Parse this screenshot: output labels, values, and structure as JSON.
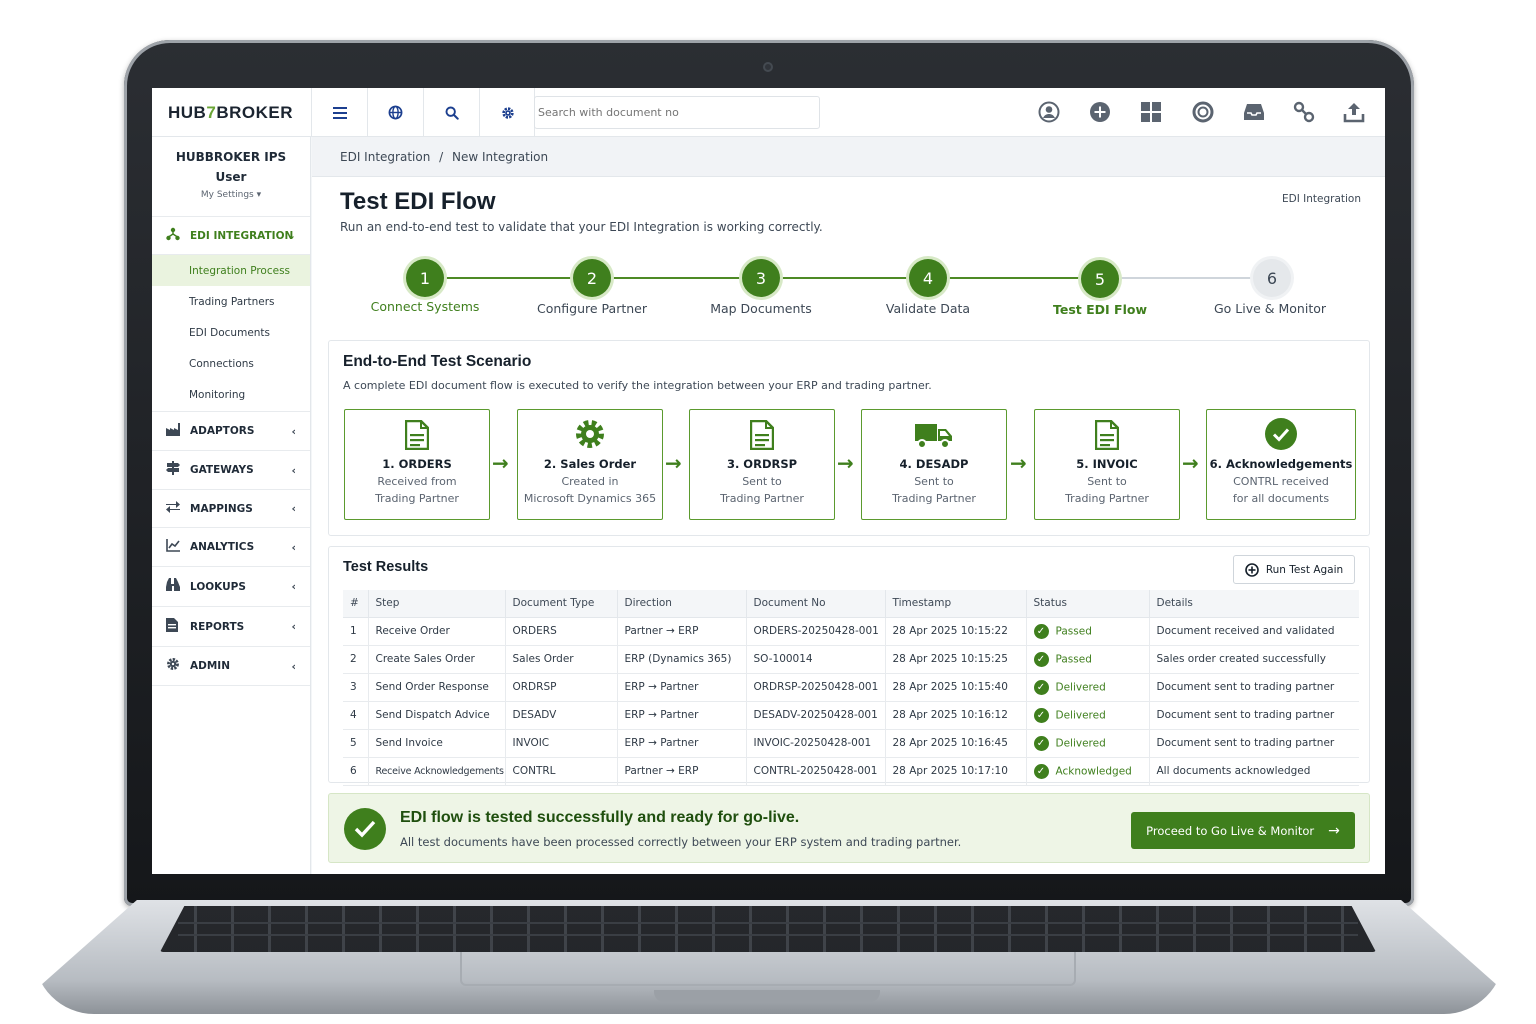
{
  "app": {
    "logo_pre": "HUB",
    "logo_mid": "7",
    "logo_post": "BROKER"
  },
  "topbar": {
    "search_placeholder": "Search with document no",
    "left_icons": [
      "menu-icon",
      "globe-icon",
      "search-icon",
      "gear-icon"
    ],
    "right_icons": [
      "user-circle-icon",
      "plus-circle-icon",
      "grid-icon",
      "support-icon",
      "inbox-icon",
      "link-icon",
      "upload-icon"
    ]
  },
  "user": {
    "name_line1": "HUBBROKER IPS",
    "name_line2": "User",
    "settings": "My Settings ▾"
  },
  "sidebar": {
    "groups": [
      {
        "label": "EDI INTEGRATION",
        "icon": "network-icon",
        "chevron": "⌄",
        "active": true,
        "items": [
          "Integration Process",
          "Trading Partners",
          "EDI Documents",
          "Connections",
          "Monitoring"
        ]
      },
      {
        "label": "ADAPTORS",
        "icon": "factory-icon",
        "chevron": "‹"
      },
      {
        "label": "GATEWAYS",
        "icon": "signpost-icon",
        "chevron": "‹"
      },
      {
        "label": "MAPPINGS",
        "icon": "arrows-icon",
        "chevron": "‹"
      },
      {
        "label": "ANALYTICS",
        "icon": "chart-icon",
        "chevron": "‹"
      },
      {
        "label": "LOOKUPS",
        "icon": "binoculars-icon",
        "chevron": "‹"
      },
      {
        "label": "REPORTS",
        "icon": "report-icon",
        "chevron": "‹"
      },
      {
        "label": "ADMIN",
        "icon": "cog-icon",
        "chevron": "‹"
      }
    ]
  },
  "breadcrumb": {
    "parent": "EDI Integration",
    "sep": "/",
    "current": "New Integration"
  },
  "page": {
    "title": "Test EDI Flow",
    "subtitle": "Run an end-to-end test to validate that your EDI Integration is working correctly.",
    "right_label": "EDI Integration"
  },
  "stepper": [
    {
      "num": "1",
      "label": "Connect Systems",
      "state": "done"
    },
    {
      "num": "2",
      "label": "Configure Partner",
      "state": "done"
    },
    {
      "num": "3",
      "label": "Map Documents",
      "state": "done"
    },
    {
      "num": "4",
      "label": "Validate Data",
      "state": "done"
    },
    {
      "num": "5",
      "label": "Test EDI Flow",
      "state": "current"
    },
    {
      "num": "6",
      "label": "Go Live & Monitor",
      "state": "pending"
    }
  ],
  "scenario": {
    "title": "End-to-End Test Scenario",
    "subtitle": "A complete EDI document flow is executed to verify the integration between your ERP and trading partner.",
    "arrow": "→",
    "steps": [
      {
        "title": "1. ORDERS",
        "line1": "Received from",
        "line2": "Trading Partner",
        "icon": "document-icon"
      },
      {
        "title": "2. Sales Order",
        "line1": "Created in",
        "line2": "Microsoft Dynamics 365",
        "icon": "gear-icon"
      },
      {
        "title": "3. ORDRSP",
        "line1": "Sent to",
        "line2": "Trading Partner",
        "icon": "document-icon"
      },
      {
        "title": "4. DESADP",
        "line1": "Sent to",
        "line2": "Trading Partner",
        "icon": "truck-icon"
      },
      {
        "title": "5. INVOIC",
        "line1": "Sent to",
        "line2": "Trading Partner",
        "icon": "document-icon"
      },
      {
        "title": "6. Acknowledgements",
        "line1": "CONTRL received",
        "line2": "for all documents",
        "icon": "check-circle-icon"
      }
    ]
  },
  "results": {
    "title": "Test Results",
    "run_again": "Run Test Again",
    "columns": [
      "#",
      "Step",
      "Document Type",
      "Direction",
      "Document No",
      "Timestamp",
      "Status",
      "Details"
    ],
    "rows": [
      [
        "1",
        "Receive Order",
        "ORDERS",
        "Partner → ERP",
        "ORDERS-20250428-001",
        "28 Apr 2025 10:15:22",
        "Passed",
        "Document received and validated"
      ],
      [
        "2",
        "Create Sales Order",
        "Sales Order",
        "ERP (Dynamics 365)",
        "SO-100014",
        "28 Apr 2025 10:15:25",
        "Passed",
        "Sales order created successfully"
      ],
      [
        "3",
        "Send Order Response",
        "ORDRSP",
        "ERP → Partner",
        "ORDRSP-20250428-001",
        "28 Apr 2025 10:15:40",
        "Delivered",
        "Document sent to trading partner"
      ],
      [
        "4",
        "Send Dispatch Advice",
        "DESADV",
        "ERP → Partner",
        "DESADV-20250428-001",
        "28 Apr 2025 10:16:12",
        "Delivered",
        "Document sent to trading partner"
      ],
      [
        "5",
        "Send Invoice",
        "INVOIC",
        "ERP → Partner",
        "INVOIC-20250428-001",
        "28 Apr 2025 10:16:45",
        "Delivered",
        "Document sent to trading partner"
      ],
      [
        "6",
        "Receive Acknowledgements",
        "CONTRL",
        "Partner → ERP",
        "CONTRL-20250428-001",
        "28 Apr 2025 10:17:10",
        "Acknowledged",
        "All documents acknowledged"
      ]
    ]
  },
  "banner": {
    "title": "EDI flow is tested successfully and ready for go-live.",
    "subtitle": "All test documents have been processed correctly between your ERP system and trading partner.",
    "button": "Proceed to Go Live & Monitor",
    "button_arrow": "→"
  },
  "colors": {
    "accent": "#3f7f1d",
    "accent_light": "#eaf3df",
    "brand_blue": "#1c3f8f"
  }
}
